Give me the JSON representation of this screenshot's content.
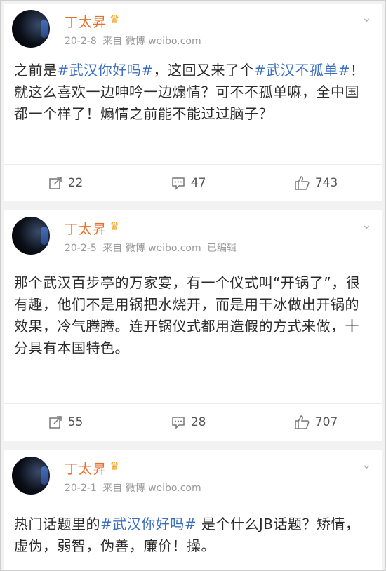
{
  "posts": [
    {
      "author": "丁太昇",
      "date": "20-2-8",
      "source": "来自 微博 weibo.com",
      "edited": "",
      "text_segments": [
        {
          "t": "之前是",
          "tag": false
        },
        {
          "t": "#武汉你好吗#",
          "tag": true
        },
        {
          "t": "，这回又来了个",
          "tag": false
        },
        {
          "t": "#武汉不孤单#",
          "tag": true
        },
        {
          "t": "！就这么喜欢一边呻吟一边煽情？可不不孤单嘛，全中国都一个样了！煽情之前能不能过过脑子？",
          "tag": false
        }
      ],
      "reposts": "22",
      "comments": "47",
      "likes": "743"
    },
    {
      "author": "丁太昇",
      "date": "20-2-5",
      "source": "来自 微博 weibo.com",
      "edited": "已编辑",
      "text_segments": [
        {
          "t": "那个武汉百步亭的万家宴，有一个仪式叫“开锅了”，很有趣，他们不是用锅把水烧开，而是用干冰做出开锅的效果，冷气腾腾。连开锅仪式都用造假的方式来做，十分具有本国特色。",
          "tag": false
        }
      ],
      "reposts": "55",
      "comments": "28",
      "likes": "707"
    },
    {
      "author": "丁太昇",
      "date": "20-2-1",
      "source": "来自 微博 weibo.com",
      "edited": "",
      "text_segments": [
        {
          "t": "热门话题里的",
          "tag": false
        },
        {
          "t": "#武汉你好吗#",
          "tag": true
        },
        {
          "t": " 是个什么JB话题？矫情，虚伪，弱智，伪善，廉价！操。",
          "tag": false
        }
      ],
      "reposts": "",
      "comments": "",
      "likes": ""
    }
  ],
  "colors": {
    "name": "#e8712a",
    "hashtag": "#3d6fc0",
    "meta": "#9a9a9a"
  },
  "icons": {
    "verified": "crown-icon",
    "menu": "chevron-down-icon",
    "repost": "repost-icon",
    "comment": "comment-icon",
    "like": "thumbs-up-icon"
  }
}
